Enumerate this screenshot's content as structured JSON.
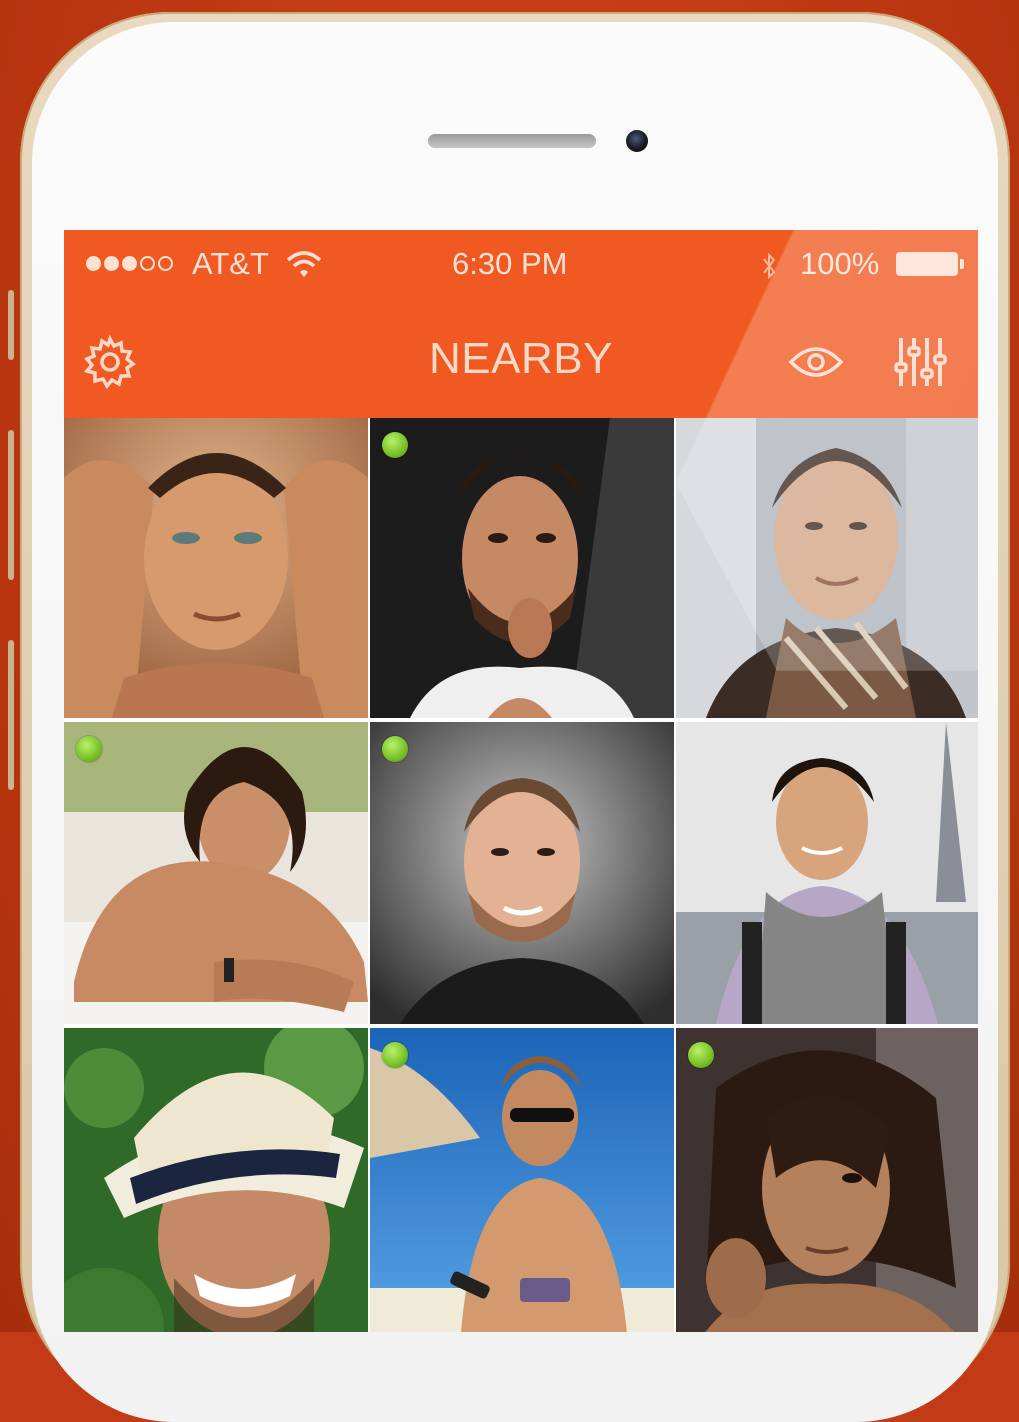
{
  "status_bar": {
    "carrier": "AT&T",
    "time": "6:30 PM",
    "battery": "100%",
    "signal_bars_filled": 3,
    "signal_bars_total": 5
  },
  "nav": {
    "title": "NEARBY",
    "left_icon": "gear-icon",
    "right_icons": [
      "eye-icon",
      "sliders-icon"
    ]
  },
  "colors": {
    "accent": "#f05a22",
    "background": "#c23a16",
    "online": "#7cc52a"
  },
  "profiles": [
    {
      "online": false
    },
    {
      "online": true
    },
    {
      "online": false
    },
    {
      "online": true
    },
    {
      "online": true
    },
    {
      "online": false
    },
    {
      "online": false
    },
    {
      "online": true
    },
    {
      "online": true
    }
  ]
}
